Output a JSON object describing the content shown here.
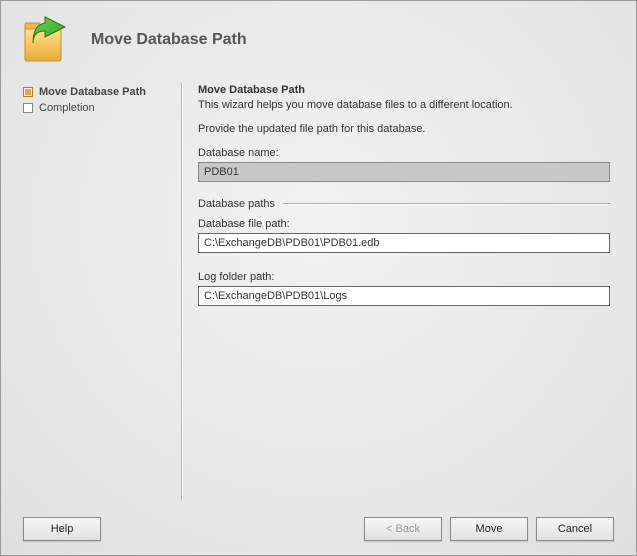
{
  "header": {
    "title": "Move Database Path"
  },
  "sidebar": {
    "steps": [
      {
        "label": "Move Database Path",
        "active": true
      },
      {
        "label": "Completion",
        "active": false
      }
    ]
  },
  "main": {
    "heading": "Move Database Path",
    "intro": "This wizard helps you move database files to a different location.",
    "prompt": "Provide the updated file path for this database.",
    "dbname_label": "Database name:",
    "dbname_value": "PDB01",
    "paths_group": "Database paths",
    "dbfile_label": "Database file path:",
    "dbfile_value": "C:\\ExchangeDB\\PDB01\\PDB01.edb",
    "logfolder_label": "Log folder path:",
    "logfolder_value": "C:\\ExchangeDB\\PDB01\\Logs"
  },
  "buttons": {
    "help": "Help",
    "back": "< Back",
    "move": "Move",
    "cancel": "Cancel"
  }
}
